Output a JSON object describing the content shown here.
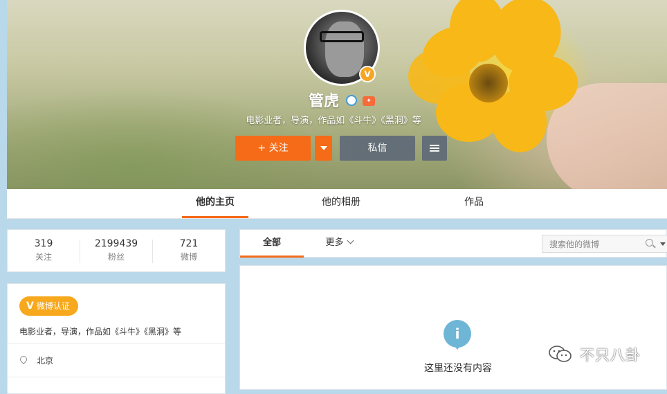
{
  "profile": {
    "name": "管虎",
    "bio": "电影业者，导演，作品如《斗牛》《黑洞》等",
    "verified_badge": "V"
  },
  "actions": {
    "follow_label": "+ 关注",
    "message_label": "私信"
  },
  "nav_tabs": [
    {
      "label": "他的主页",
      "active": true
    },
    {
      "label": "他的相册",
      "active": false
    },
    {
      "label": "作品",
      "active": false
    }
  ],
  "stats": [
    {
      "value": "319",
      "label": "关注"
    },
    {
      "value": "2199439",
      "label": "粉丝"
    },
    {
      "value": "721",
      "label": "微博"
    }
  ],
  "info": {
    "verify_badge_label": "微博认证",
    "verify_v": "V",
    "bio": "电影业者，导演，作品如《斗牛》《黑洞》等",
    "location": "北京"
  },
  "feed": {
    "tabs": [
      {
        "label": "全部",
        "active": true
      },
      {
        "label": "更多",
        "active": false
      }
    ],
    "search_placeholder": "搜索他的微博",
    "empty_icon": "i",
    "empty_text": "这里还没有内容"
  },
  "watermark": {
    "text": "不只八卦",
    "icon": "wechat-icon"
  },
  "colors": {
    "accent": "#f56b18",
    "secondary_button": "#5f6a78",
    "verify_badge": "#f7a81c",
    "info_icon": "#6fb5d6",
    "page_bg": "#b9d8ea"
  }
}
